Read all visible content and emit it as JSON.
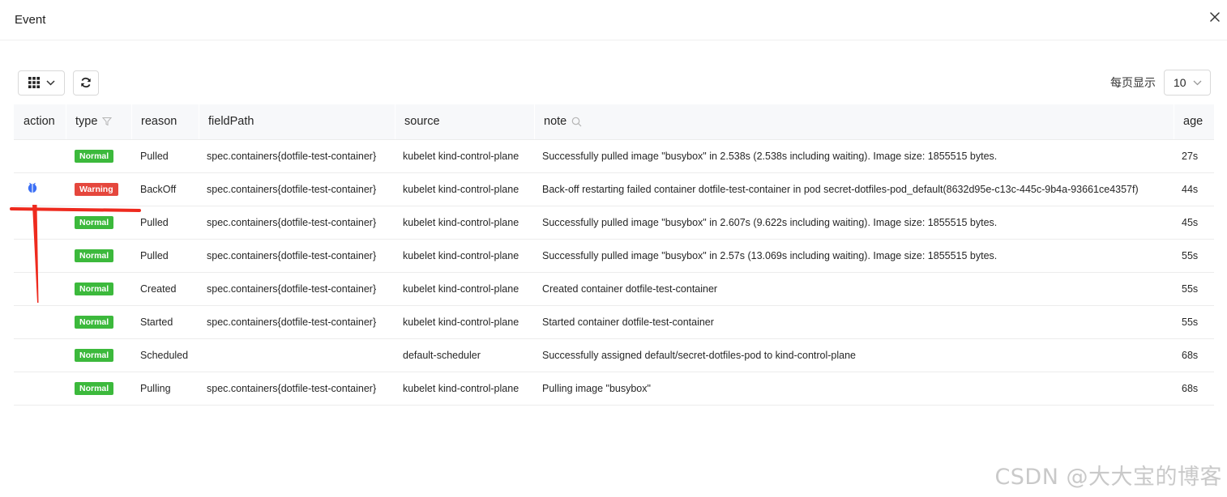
{
  "modal": {
    "title": "Event"
  },
  "toolbar": {
    "page_size_label": "每页显示",
    "page_size_value": "10"
  },
  "table": {
    "columns": [
      "action",
      "type",
      "reason",
      "fieldPath",
      "source",
      "note",
      "age"
    ],
    "rows": [
      {
        "type": "Normal",
        "reason": "Pulled",
        "fieldPath": "spec.containers{dotfile-test-container}",
        "source": "kubelet kind-control-plane",
        "note": "Successfully pulled image \"busybox\" in 2.538s (2.538s including waiting). Image size: 1855515 bytes.",
        "age": "27s",
        "has_action": false
      },
      {
        "type": "Warning",
        "reason": "BackOff",
        "fieldPath": "spec.containers{dotfile-test-container}",
        "source": "kubelet kind-control-plane",
        "note": "Back-off restarting failed container dotfile-test-container in pod secret-dotfiles-pod_default(8632d95e-c13c-445c-9b4a-93661ce4357f)",
        "age": "44s",
        "has_action": true
      },
      {
        "type": "Normal",
        "reason": "Pulled",
        "fieldPath": "spec.containers{dotfile-test-container}",
        "source": "kubelet kind-control-plane",
        "note": "Successfully pulled image \"busybox\" in 2.607s (9.622s including waiting). Image size: 1855515 bytes.",
        "age": "45s",
        "has_action": false
      },
      {
        "type": "Normal",
        "reason": "Pulled",
        "fieldPath": "spec.containers{dotfile-test-container}",
        "source": "kubelet kind-control-plane",
        "note": "Successfully pulled image \"busybox\" in 2.57s (13.069s including waiting). Image size: 1855515 bytes.",
        "age": "55s",
        "has_action": false
      },
      {
        "type": "Normal",
        "reason": "Created",
        "fieldPath": "spec.containers{dotfile-test-container}",
        "source": "kubelet kind-control-plane",
        "note": "Created container dotfile-test-container",
        "age": "55s",
        "has_action": false
      },
      {
        "type": "Normal",
        "reason": "Started",
        "fieldPath": "spec.containers{dotfile-test-container}",
        "source": "kubelet kind-control-plane",
        "note": "Started container dotfile-test-container",
        "age": "55s",
        "has_action": false
      },
      {
        "type": "Normal",
        "reason": "Scheduled",
        "fieldPath": "",
        "source": "default-scheduler",
        "note": "Successfully assigned default/secret-dotfiles-pod to kind-control-plane",
        "age": "68s",
        "has_action": false
      },
      {
        "type": "Normal",
        "reason": "Pulling",
        "fieldPath": "spec.containers{dotfile-test-container}",
        "source": "kubelet kind-control-plane",
        "note": "Pulling image \"busybox\"",
        "age": "68s",
        "has_action": false
      }
    ]
  },
  "icons": {
    "close": "close-icon",
    "grid": "grid-icon",
    "chevron": "chevron-down-icon",
    "refresh": "refresh-icon",
    "filter": "filter-icon",
    "search": "search-icon",
    "action": "bug-icon"
  },
  "colors": {
    "normal": "#3cb93c",
    "warning": "#e5473d",
    "action_icon": "#3b6ff5",
    "annotation": "#ee2a1e"
  },
  "watermark": "CSDN @大大宝的博客"
}
